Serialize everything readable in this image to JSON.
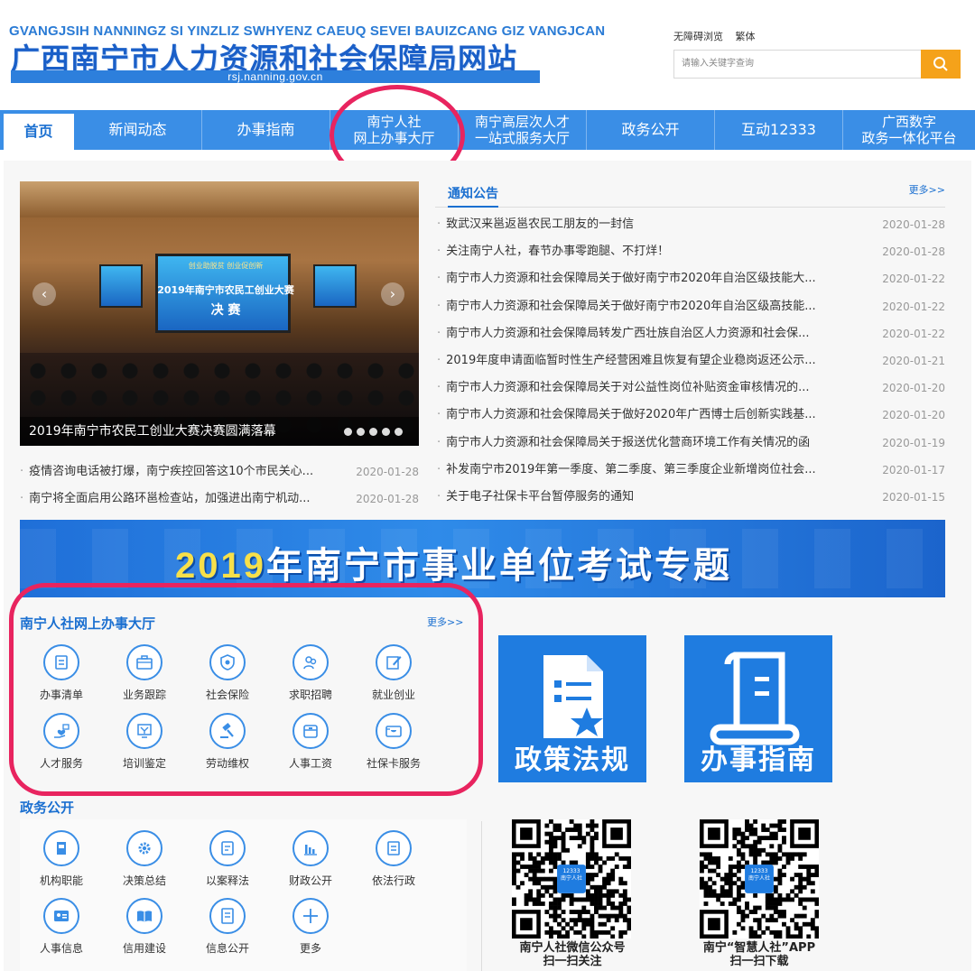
{
  "header": {
    "pinyin": "GVANGJSIH NANNINGZ SI YINZLIZ SWHYENZ CAEUQ SEVEI BAUIZCANG GIZ VANGJCAN",
    "title": "广西南宁市人力资源和社会保障局网站",
    "domain": "rsj.nanning.gov.cn",
    "links": [
      "无障碍浏览",
      "繁体"
    ],
    "search_placeholder": "请输入关键字查询"
  },
  "nav": {
    "items": [
      {
        "line1": "首页",
        "line2": ""
      },
      {
        "line1": "新闻动态",
        "line2": ""
      },
      {
        "line1": "办事指南",
        "line2": ""
      },
      {
        "line1": "南宁人社",
        "line2": "网上办事大厅"
      },
      {
        "line1": "南宁高层次人才",
        "line2": "一站式服务大厅"
      },
      {
        "line1": "政务公开",
        "line2": ""
      },
      {
        "line1": "互动12333",
        "line2": ""
      },
      {
        "line1": "广西数字",
        "line2": "政务一体化平台"
      }
    ]
  },
  "carousel": {
    "caption": "2019年南宁市农民工创业大赛决赛圆满落幕",
    "screen_top": "创业助脱贫 创业促创新",
    "screen_title": "2019年南宁市农民工创业大赛",
    "screen_sub": "决 赛",
    "dots": 5,
    "active_dot": 1
  },
  "left_news": [
    {
      "title": "疫情咨询电话被打爆，南宁疾控回答这10个市民关心...",
      "date": "2020-01-28"
    },
    {
      "title": "南宁将全面启用公路环邕检查站，加强进出南宁机动...",
      "date": "2020-01-28"
    }
  ],
  "notice": {
    "title": "通知公告",
    "more": "更多>>",
    "items": [
      {
        "title": "致武汉来邕返邕农民工朋友的一封信",
        "date": "2020-01-28"
      },
      {
        "title": "关注南宁人社，春节办事零跑腿、不打烊！",
        "date": "2020-01-28"
      },
      {
        "title": "南宁市人力资源和社会保障局关于做好南宁市2020年自治区级技能大...",
        "date": "2020-01-22"
      },
      {
        "title": "南宁市人力资源和社会保障局关于做好南宁市2020年自治区级高技能...",
        "date": "2020-01-22"
      },
      {
        "title": "南宁市人力资源和社会保障局转发广西壮族自治区人力资源和社会保...",
        "date": "2020-01-22"
      },
      {
        "title": "2019年度申请面临暂时性生产经营困难且恢复有望企业稳岗返还公示...",
        "date": "2020-01-21"
      },
      {
        "title": "南宁市人力资源和社会保障局关于对公益性岗位补贴资金审核情况的...",
        "date": "2020-01-20"
      },
      {
        "title": "南宁市人力资源和社会保障局关于做好2020年广西博士后创新实践基...",
        "date": "2020-01-20"
      },
      {
        "title": "南宁市人力资源和社会保障局关于报送优化营商环境工作有关情况的函",
        "date": "2020-01-19"
      },
      {
        "title": "补发南宁市2019年第一季度、第二季度、第三季度企业新增岗位社会...",
        "date": "2020-01-17"
      },
      {
        "title": "关于电子社保卡平台暂停服务的通知",
        "date": "2020-01-15"
      }
    ]
  },
  "banner": {
    "year": "2019",
    "text": "年南宁市事业单位考试专题"
  },
  "service": {
    "title": "南宁人社网上办事大厅",
    "more": "更多>>",
    "items": [
      {
        "label": "办事清单",
        "icon": "list-icon"
      },
      {
        "label": "业务跟踪",
        "icon": "briefcase-icon"
      },
      {
        "label": "社会保险",
        "icon": "shield-icon"
      },
      {
        "label": "求职招聘",
        "icon": "people-icon"
      },
      {
        "label": "就业创业",
        "icon": "edit-icon"
      },
      {
        "label": "人才服务",
        "icon": "hand-heart-icon"
      },
      {
        "label": "培训鉴定",
        "icon": "certificate-icon"
      },
      {
        "label": "劳动维权",
        "icon": "gavel-icon"
      },
      {
        "label": "人事工资",
        "icon": "wallet-icon"
      },
      {
        "label": "社保卡服务",
        "icon": "card-icon"
      }
    ]
  },
  "tiles": [
    {
      "label": "政策法规",
      "icon": "document-star-icon"
    },
    {
      "label": "办事指南",
      "icon": "scroll-icon"
    }
  ],
  "gov": {
    "title": "政务公开",
    "items": [
      {
        "label": "机构职能",
        "icon": "book-icon"
      },
      {
        "label": "决策总结",
        "icon": "gear-icon"
      },
      {
        "label": "以案释法",
        "icon": "notebook-icon"
      },
      {
        "label": "财政公开",
        "icon": "bar-chart-icon"
      },
      {
        "label": "依法行政",
        "icon": "list-icon"
      },
      {
        "label": "人事信息",
        "icon": "id-card-icon"
      },
      {
        "label": "信用建设",
        "icon": "open-book-icon"
      },
      {
        "label": "信息公开",
        "icon": "document-icon"
      },
      {
        "label": "更多",
        "icon": "plus-icon"
      }
    ]
  },
  "qr": [
    {
      "line1": "南宁人社微信公众号",
      "line2": "扫一扫关注",
      "badge1": "12333",
      "badge2": "南宁人社"
    },
    {
      "line1": "南宁“智慧人社”APP",
      "line2": "扫一扫下载",
      "badge1": "12333",
      "badge2": "南宁人社"
    }
  ],
  "colors": {
    "nav": "#3a8ee6",
    "accent": "#1a6fd0",
    "search": "#f5a21a",
    "highlight": "#e8245f",
    "tile": "#1f7ce0"
  }
}
